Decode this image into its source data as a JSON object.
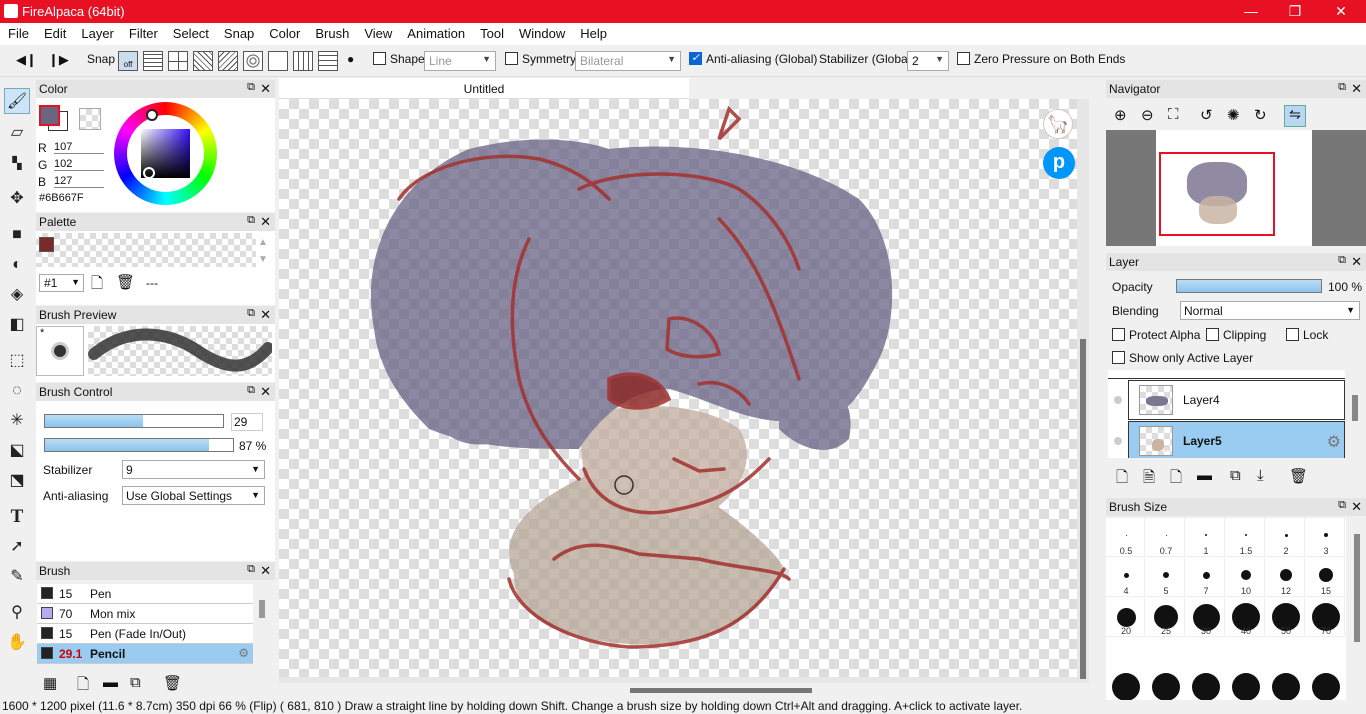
{
  "app": {
    "title": "FireAlpaca (64bit)"
  },
  "menu": [
    "File",
    "Edit",
    "Layer",
    "Filter",
    "Select",
    "Snap",
    "Color",
    "Brush",
    "View",
    "Animation",
    "Tool",
    "Window",
    "Help"
  ],
  "toolbar": {
    "snap": "Snap",
    "snap_off": "off",
    "shape_label": "Shape",
    "shape_value": "Line",
    "symmetry_label": "Symmetry",
    "symmetry_value": "Bilateral",
    "antialias_label": "Anti-aliasing (Global)",
    "stabilizer_label": "Stabilizer (Global)",
    "stabilizer_value": "2",
    "zero_pressure_label": "Zero Pressure on Both Ends"
  },
  "color_panel": {
    "title": "Color",
    "r_label": "R",
    "r": "107",
    "g_label": "G",
    "g": "102",
    "b_label": "B",
    "b": "127",
    "hex": "#6B667F",
    "color": "#6b667f"
  },
  "palette_panel": {
    "title": "Palette",
    "selector": "#1",
    "name": "---",
    "swatch": "#7a2a2a"
  },
  "brush_preview": {
    "title": "Brush Preview",
    "star": "*"
  },
  "brush_control": {
    "title": "Brush Control",
    "size": "29",
    "size_fill": 0.55,
    "opacity": "87 %",
    "opacity_fill": 0.87,
    "stabilizer_label": "Stabilizer",
    "stabilizer": "9",
    "antialias_label": "Anti-aliasing",
    "antialias": "Use Global Settings"
  },
  "brush_panel": {
    "title": "Brush",
    "items": [
      {
        "size": "15",
        "name": "Pen",
        "color": "#222222"
      },
      {
        "size": "70",
        "name": "Mon mix",
        "color": "#b9a9f0"
      },
      {
        "size": "15",
        "name": "Pen (Fade In/Out)",
        "color": "#222222"
      },
      {
        "size": "29.1",
        "name": "Pencil",
        "color": "#222222"
      }
    ]
  },
  "canvas": {
    "tab": "Untitled"
  },
  "navigator": {
    "title": "Navigator"
  },
  "layer_panel": {
    "title": "Layer",
    "opacity_label": "Opacity",
    "opacity": "100 %",
    "blending_label": "Blending",
    "blending": "Normal",
    "protect_alpha": "Protect Alpha",
    "clipping": "Clipping",
    "lock": "Lock",
    "show_active": "Show only Active Layer",
    "layers": [
      "Layer4",
      "Layer5"
    ]
  },
  "brush_size": {
    "title": "Brush Size",
    "sizes": [
      "0.5",
      "0.7",
      "1",
      "1.5",
      "2",
      "3",
      "4",
      "5",
      "7",
      "10",
      "12",
      "15",
      "20",
      "25",
      "30",
      "40",
      "50",
      "70"
    ]
  },
  "status": "1600 * 1200 pixel   (11.6 * 8.7cm)   350 dpi   66 % (Flip)   ( 681, 810 )   Draw a straight line by holding down Shift. Change a brush size by holding down Ctrl+Alt and dragging. A+click to activate layer."
}
